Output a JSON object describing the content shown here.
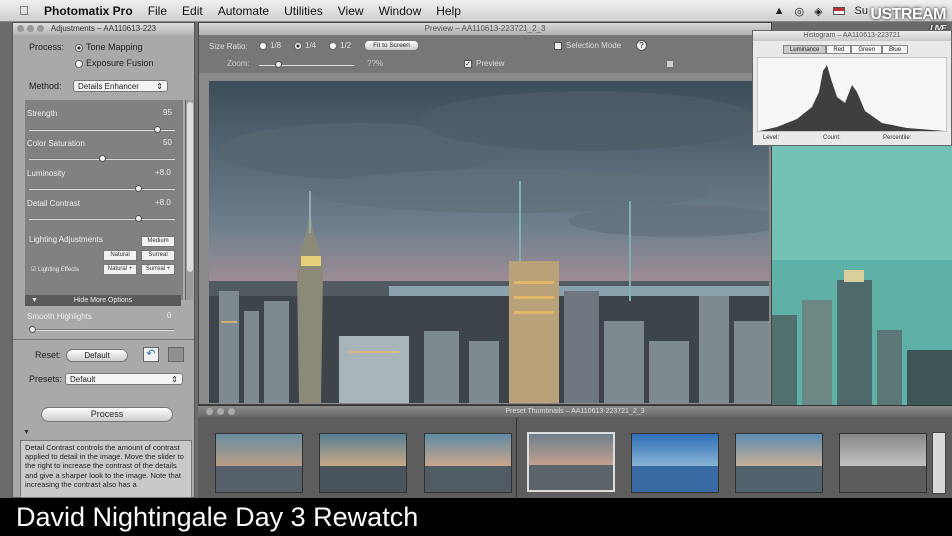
{
  "menubar": {
    "app_name": "Photomatix Pro",
    "items": [
      "File",
      "Edit",
      "Automate",
      "Utilities",
      "View",
      "Window",
      "Help"
    ],
    "right_status": "Su"
  },
  "overlay": {
    "brand": "USTREAM",
    "live": "LIVE"
  },
  "adjustments": {
    "title": "Adjustments – AA110613-223",
    "process_label": "Process:",
    "process_options": [
      "Tone Mapping",
      "Exposure Fusion"
    ],
    "method_label": "Method:",
    "method_value": "Details Enhancer",
    "sliders": [
      {
        "label": "Strength",
        "value": "95",
        "level": 0.9
      },
      {
        "label": "Color Saturation",
        "value": "50",
        "level": 0.5
      },
      {
        "label": "Luminosity",
        "value": "+8.0",
        "level": 0.76
      },
      {
        "label": "Detail Contrast",
        "value": "+8.0",
        "level": 0.76
      }
    ],
    "lighting_label": "Lighting Adjustments",
    "lighting_buttons": [
      "Medium",
      "Natural",
      "Surreal"
    ],
    "lighting_effects_label": "Lighting Effects",
    "lighting_effect_buttons": [
      "Natural +",
      "Surreal +"
    ],
    "hide_more": "Hide More Options",
    "smooth_label": "Smooth Highlights",
    "smooth_value": "0",
    "reset_label": "Reset:",
    "reset_value": "Default",
    "presets_label": "Presets:",
    "presets_value": "Default",
    "process_button": "Process",
    "description": "Detail Contrast controls the amount of contrast applied to detail in the image. Move the slider to the right to increase the contrast of the details and give a sharper look to the image. Note that increasing the contrast also has a"
  },
  "preview": {
    "title": "Preview – AA110613-223721_2_3",
    "size_ratio_label": "Size Ratio:",
    "ratios": [
      "1/8",
      "1/4",
      "1/2"
    ],
    "fit_button": "Fit to Screen",
    "selection_mode": "Selection Mode",
    "help": "?",
    "zoom_label": "Zoom:",
    "zoom_value": "??%",
    "preview_checkbox": "Preview"
  },
  "histogram": {
    "title": "Histogram – AA110613-223721",
    "tabs": [
      "Luminance",
      "Red",
      "Green",
      "Blue"
    ],
    "footer": [
      "Level:",
      "Count:",
      "Percentile:"
    ]
  },
  "thumbnails": {
    "title": "Preset Thumbnails – AA110613-223721_2_3",
    "count": 7,
    "selected_index": 3
  },
  "caption": "David Nightingale Day 3 Rewatch",
  "colors": {
    "panel": "#a9a9a9",
    "accent": "#4ea1d3",
    "caption_bg": "#000000"
  }
}
